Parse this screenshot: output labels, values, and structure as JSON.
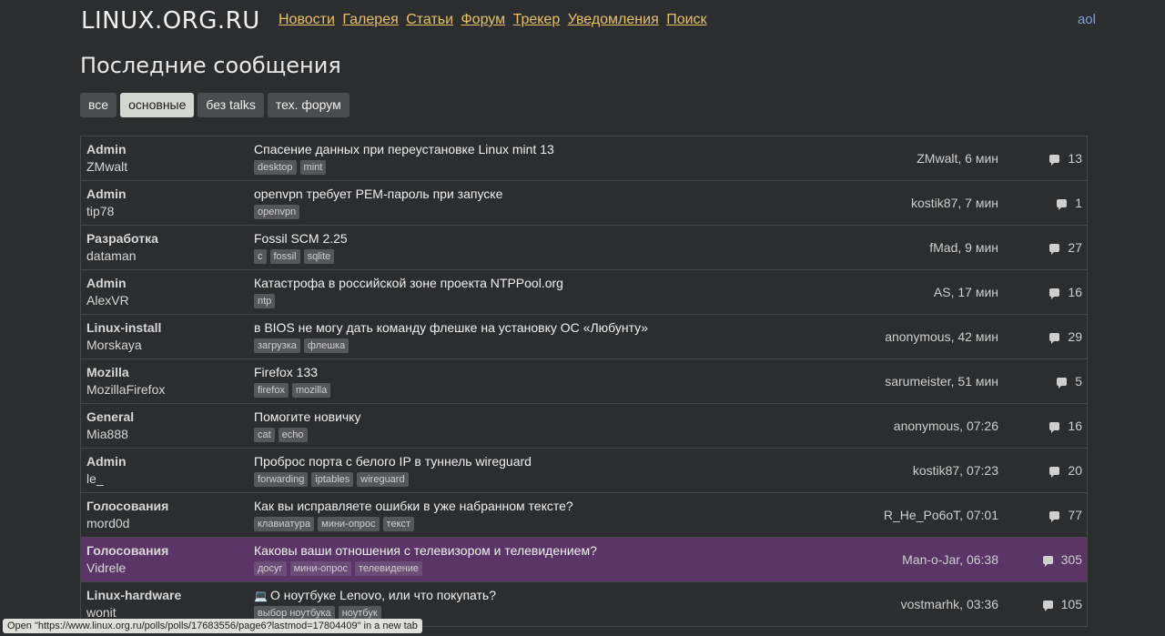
{
  "header": {
    "logo": "LINUX.ORG.RU",
    "nav": [
      "Новости",
      "Галерея",
      "Статьи",
      "Форум",
      "Трекер",
      "Уведомления",
      "Поиск"
    ],
    "user": "aol"
  },
  "page_title": "Последние сообщения",
  "filters": [
    "все",
    "основные",
    "без talks",
    "тех. форум"
  ],
  "active_filter": "основные",
  "rows": [
    {
      "group": "Admin",
      "author": "ZMwalt",
      "title": "Спасение данных при переустановке Linux mint 13",
      "tags": [
        "desktop",
        "mint"
      ],
      "last": "ZMwalt, 6 мин",
      "count": "13"
    },
    {
      "group": "Admin",
      "author": "tip78",
      "title": "openvpn требует PEM-пароль при запуске",
      "tags": [
        "openvpn"
      ],
      "last": "kostik87, 7 мин",
      "count": "1"
    },
    {
      "group": "Разработка",
      "author": "dataman",
      "title": "Fossil SCM 2.25",
      "tags": [
        "c",
        "fossil",
        "sqlite"
      ],
      "last": "fMad, 9 мин",
      "count": "27"
    },
    {
      "group": "Admin",
      "author": "AlexVR",
      "title": "Катастрофа в российской зоне проекта NTPPool.org",
      "tags": [
        "ntp"
      ],
      "last": "AS, 17 мин",
      "count": "16"
    },
    {
      "group": "Linux-install",
      "author": "Morskaya",
      "title": "в BIOS не могу дать команду флешке на установку ОС «Любунту»",
      "tags": [
        "загрузка",
        "флешка"
      ],
      "last": "anonymous, 42 мин",
      "count": "29"
    },
    {
      "group": "Mozilla",
      "author": "MozillaFirefox",
      "title": "Firefox 133",
      "tags": [
        "firefox",
        "mozilla"
      ],
      "last": "sarumeister, 51 мин",
      "count": "5"
    },
    {
      "group": "General",
      "author": "Mia888",
      "title": "Помогите новичку",
      "tags": [
        "cat",
        "echo"
      ],
      "last": "anonymous, 07:26",
      "count": "16"
    },
    {
      "group": "Admin",
      "author": "le_",
      "title": "Проброс порта с белого IP в туннель wireguard",
      "tags": [
        "forwarding",
        "iptables",
        "wireguard"
      ],
      "last": "kostik87, 07:23",
      "count": "20"
    },
    {
      "group": "Голосования",
      "author": "mord0d",
      "title": "Как вы исправляете ошибки в уже набранном тексте?",
      "tags": [
        "клавиатура",
        "мини-опрос",
        "текст"
      ],
      "last": "R_He_Po6oT, 07:01",
      "count": "77"
    },
    {
      "group": "Голосования",
      "author": "Vidrele",
      "title": "Каковы ваши отношения с телевизором и телевидением?",
      "tags": [
        "досуг",
        "мини-опрос",
        "телевидение"
      ],
      "last": "Man-o-Jar, 06:38",
      "count": "305",
      "highlight": true
    },
    {
      "group": "Linux-hardware",
      "author": "wonit",
      "title": "О ноутбуке Lenovo, или что покупать?",
      "tags": [
        "выбор ноутбука",
        "ноутбук"
      ],
      "last": "vostmarhk, 03:36",
      "count": "105",
      "icon": "laptop-icon"
    }
  ],
  "status_bar": "Open \"https://www.linux.org.ru/polls/polls/17683556/page6?lastmod=17804409\" in a new tab"
}
